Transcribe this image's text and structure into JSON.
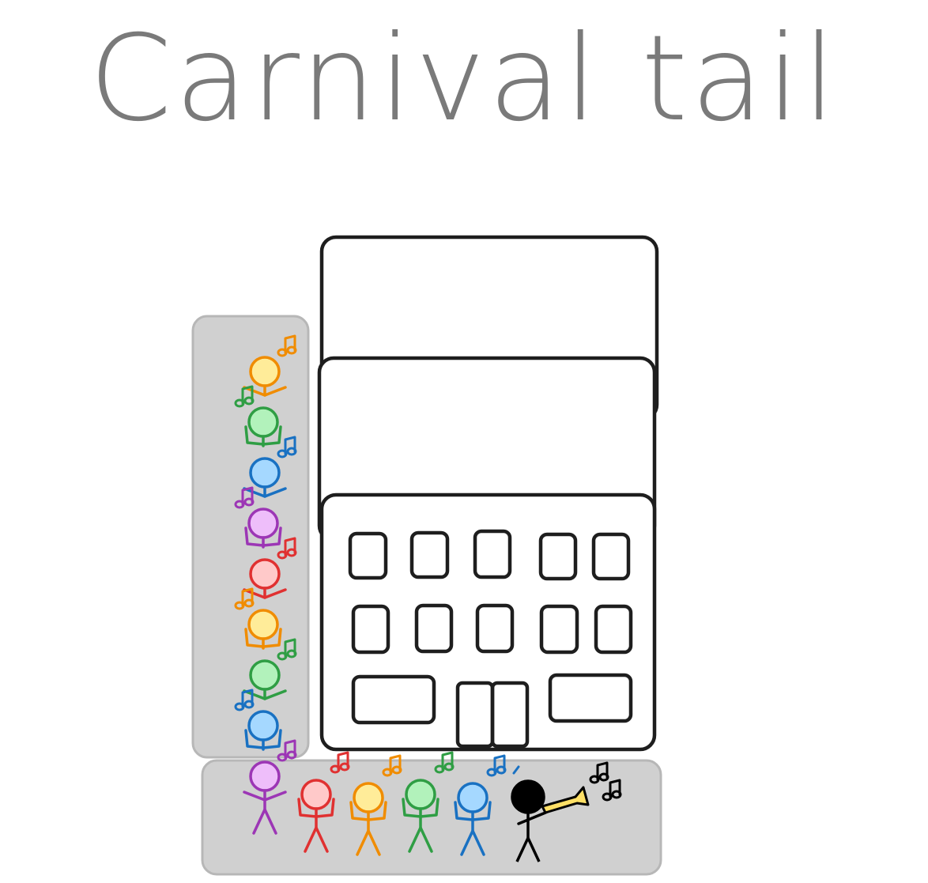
{
  "title": "Carnival tail",
  "colors": {
    "title": "#7a7a7a",
    "lane_fill": "#d0d0d0",
    "building_stroke": "#1e1e1e",
    "orange": {
      "line": "#f08c00",
      "fill": "#ffec99"
    },
    "green": {
      "line": "#2f9e44",
      "fill": "#b2f2bb"
    },
    "blue": {
      "line": "#1971c2",
      "fill": "#a5d8ff"
    },
    "purple": {
      "line": "#9c36b5",
      "fill": "#eebefa"
    },
    "red": {
      "line": "#e03131",
      "fill": "#ffc9c9"
    },
    "leader": {
      "line": "#000000",
      "fill": "#000000"
    },
    "trumpet": "#ffe066"
  },
  "vertical_column_colors": [
    "orange",
    "green",
    "blue",
    "purple",
    "red",
    "orange",
    "green",
    "blue",
    "purple"
  ],
  "bottom_row_colors": [
    "red",
    "orange",
    "green",
    "blue"
  ],
  "icons": [
    "music-note-icon",
    "trumpet-icon",
    "stick-figure-icon",
    "building-icon"
  ]
}
